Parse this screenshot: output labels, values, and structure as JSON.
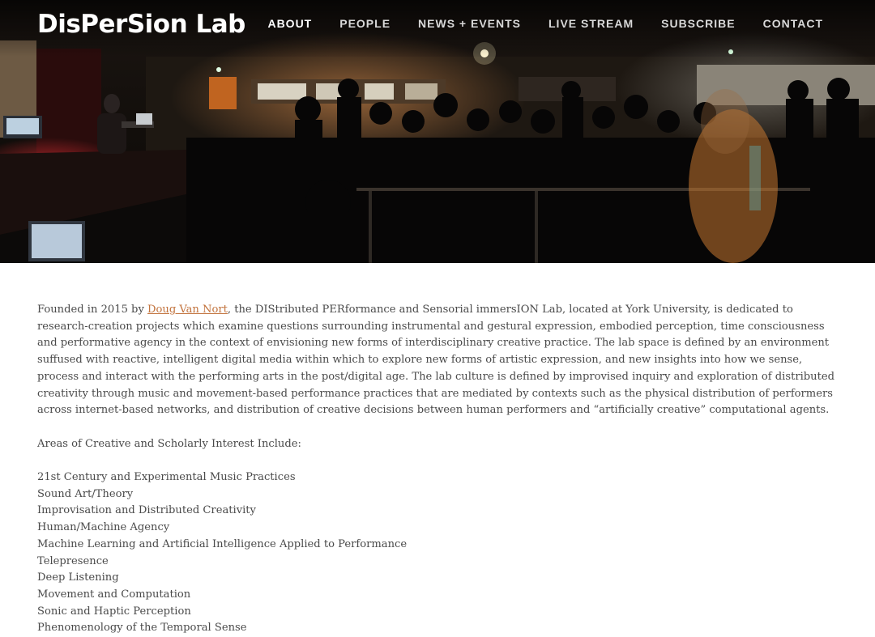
{
  "header": {
    "site_title": "DisPerSion Lab",
    "nav": [
      {
        "label": "ABOUT",
        "active": true
      },
      {
        "label": "PEOPLE",
        "active": false
      },
      {
        "label": "NEWS + EVENTS",
        "active": false
      },
      {
        "label": "LIVE STREAM",
        "active": false
      },
      {
        "label": "SUBSCRIBE",
        "active": false
      },
      {
        "label": "CONTACT",
        "active": false
      }
    ]
  },
  "hero": {
    "subject": "performance venue with audience and stage"
  },
  "intro": {
    "lead": "Founded in 2015 by ",
    "link_text": "Doug Van Nort",
    "body": ", the DIStributed PERformance and Sensorial immersION Lab, located at York University, is dedicated to research-creation projects which examine questions surrounding instrumental and gestural expression, embodied perception, time consciousness and performative agency in the context of envisioning new forms of interdisciplinary creative practice. The lab space is defined by an environment suffused with reactive, intelligent digital media within which to explore new forms of artistic expression, and new insights into how we sense, process and interact with the performing arts in the post/digital age. The lab culture is defined by improvised inquiry and exploration of distributed creativity through music and movement-based performance practices that are mediated by contexts such as the physical distribution of performers across internet-based networks, and distribution of creative decisions between human performers and “artificially creative” computational agents."
  },
  "areas": {
    "heading": "Areas of Creative and Scholarly Interest Include:",
    "items": [
      "21st Century and Experimental Music Practices",
      "Sound Art/Theory",
      "Improvisation and Distributed Creativity",
      "Human/Machine Agency",
      "Machine Learning and Artificial Intelligence Applied to Performance",
      "Telepresence",
      "Deep Listening",
      "Movement and Computation",
      "Sonic and Haptic Perception",
      "Phenomenology of the Temporal Sense"
    ]
  },
  "colors": {
    "link": "#c2733d",
    "body_text": "#4a4a4a",
    "nav_active": "#ffffff",
    "nav_inactive": "#d9d9d9"
  }
}
